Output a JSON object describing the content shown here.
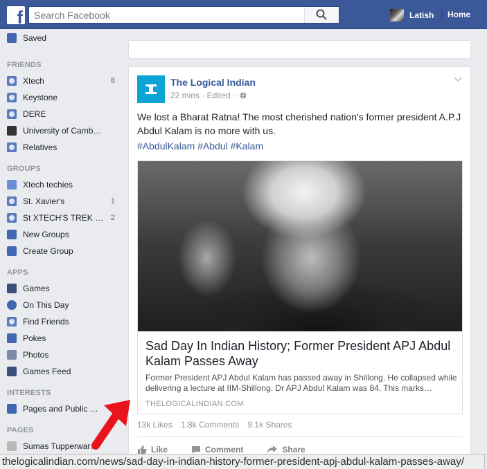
{
  "topbar": {
    "logo": "f",
    "search_placeholder": "Search Facebook",
    "user_name": "Latish",
    "home_label": "Home"
  },
  "sidebar": {
    "saved": "Saved",
    "friends_heading": "FRIENDS",
    "friends": [
      {
        "label": "Xtech",
        "count": "8"
      },
      {
        "label": "Keystone",
        "count": ""
      },
      {
        "label": "DERE",
        "count": ""
      },
      {
        "label": "University of Camb…",
        "count": ""
      },
      {
        "label": "Relatives",
        "count": ""
      }
    ],
    "groups_heading": "GROUPS",
    "groups": [
      {
        "label": "Xtech techies",
        "count": ""
      },
      {
        "label": "St. Xavier's",
        "count": "1"
      },
      {
        "label": "St XTECH'S TREK …",
        "count": "2"
      },
      {
        "label": "New Groups",
        "count": ""
      },
      {
        "label": "Create Group",
        "count": ""
      }
    ],
    "apps_heading": "APPS",
    "apps": [
      {
        "label": "Games"
      },
      {
        "label": "On This Day"
      },
      {
        "label": "Find Friends"
      },
      {
        "label": "Pokes"
      },
      {
        "label": "Photos"
      },
      {
        "label": "Games Feed"
      }
    ],
    "interests_heading": "INTERESTS",
    "interests": [
      {
        "label": "Pages and Public …"
      }
    ],
    "pages_heading": "PAGES",
    "pages": [
      {
        "label": "Sumas Tupperwar…"
      }
    ]
  },
  "post": {
    "page_name": "The Logical Indian",
    "meta": "22 mins · Edited ·",
    "text": "We lost a Bharat Ratna! The most cherished nation's former president A.P.J Abdul Kalam is no more with us.",
    "hashtags": "#AbdulKalam #Abdul #Kalam",
    "link_title": "Sad Day In Indian History; Former President APJ Abdul Kalam Passes Away",
    "link_desc": "Former President APJ Abdul Kalam has passed away in Shillong. He collapsed while delivering a lecture at IIM-Shillong. Dr APJ Abdul Kalam was 84. This marks…",
    "link_domain": "THELOGICALINDIAN.COM",
    "likes": "13k Likes",
    "comments": "1.8k Comments",
    "shares": "9.1k Shares",
    "like_label": "Like",
    "comment_label": "Comment",
    "share_label": "Share"
  },
  "statusbar": {
    "url": "thelogicalindian.com/news/sad-day-in-indian-history-former-president-apj-abdul-kalam-passes-away/"
  },
  "colors": {
    "brand": "#3b5998",
    "link": "#365899",
    "annotation": "#e8141b"
  }
}
